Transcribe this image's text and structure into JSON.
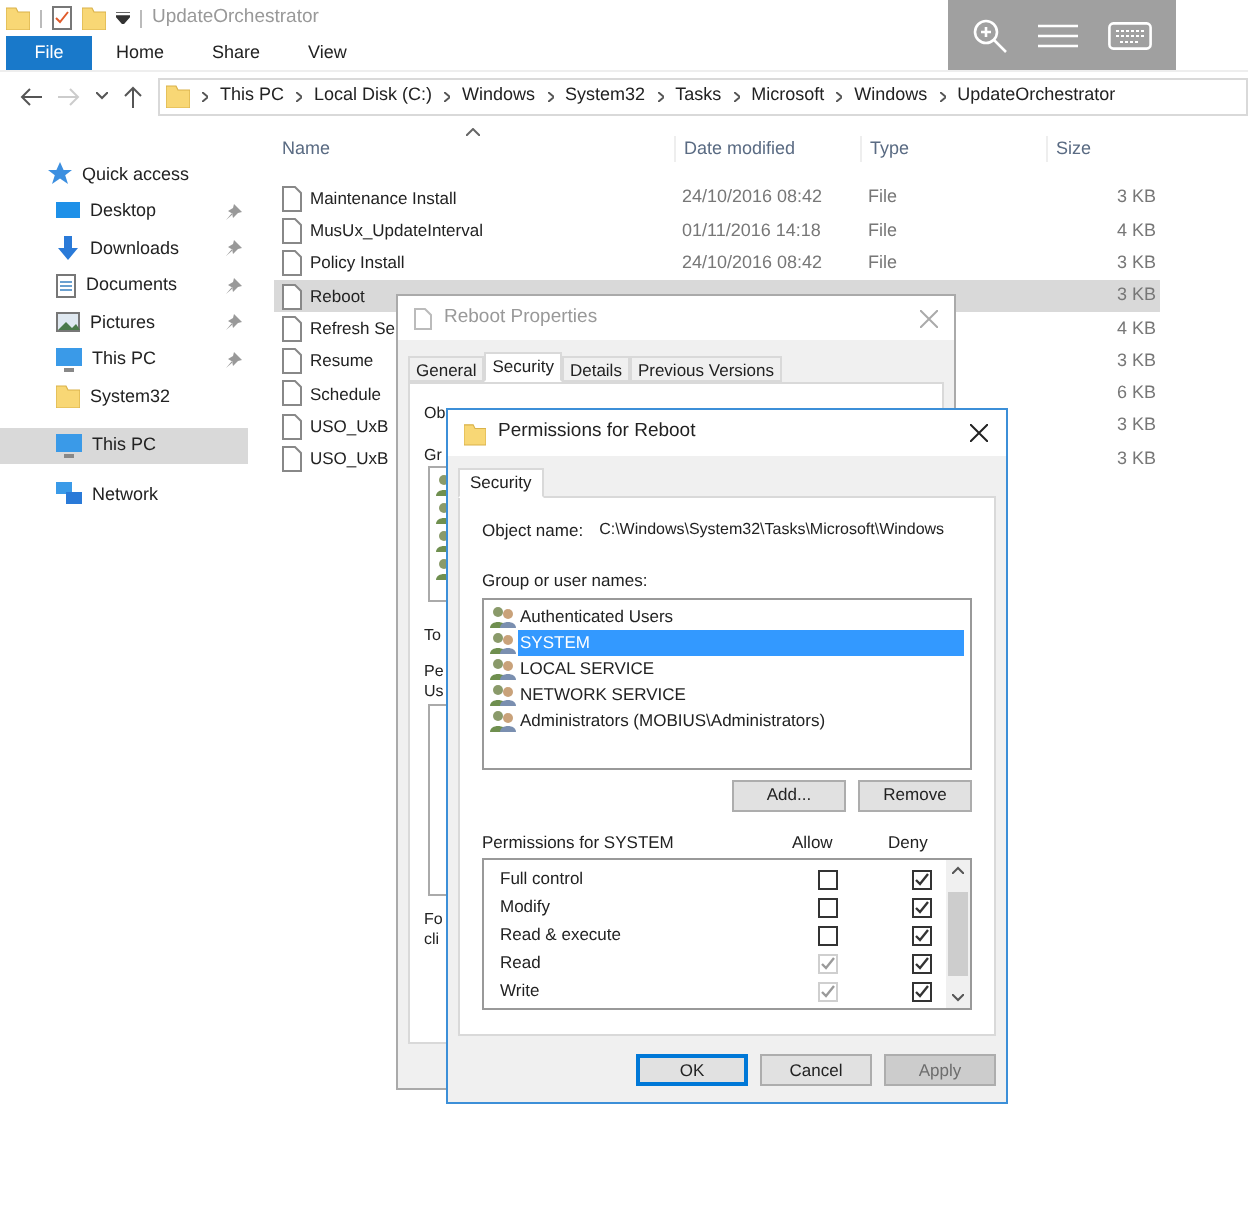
{
  "window": {
    "title": "UpdateOrchestrator"
  },
  "ribbon_tabs": [
    {
      "label": "File",
      "selected": true
    },
    {
      "label": "Home",
      "selected": false
    },
    {
      "label": "Share",
      "selected": false
    },
    {
      "label": "View",
      "selected": false
    }
  ],
  "address": {
    "crumbs": [
      "This PC",
      "Local Disk (C:)",
      "Windows",
      "System32",
      "Tasks",
      "Microsoft",
      "Windows",
      "UpdateOrchestrator"
    ]
  },
  "sidebar": {
    "items": [
      {
        "label": "Quick access",
        "pinned": false,
        "selected": false
      },
      {
        "label": "Desktop",
        "pinned": true,
        "selected": false
      },
      {
        "label": "Downloads",
        "pinned": true,
        "selected": false
      },
      {
        "label": "Documents",
        "pinned": true,
        "selected": false
      },
      {
        "label": "Pictures",
        "pinned": true,
        "selected": false
      },
      {
        "label": "This PC",
        "pinned": true,
        "selected": false
      },
      {
        "label": "System32",
        "pinned": false,
        "selected": false
      },
      {
        "label": "This PC",
        "pinned": false,
        "selected": true
      },
      {
        "label": "Network",
        "pinned": false,
        "selected": false
      }
    ]
  },
  "table": {
    "columns": [
      "Name",
      "Date modified",
      "Type",
      "Size"
    ],
    "rows": [
      {
        "name": "Maintenance Install",
        "date": "24/10/2016 08:42",
        "type": "File",
        "size": "3 KB",
        "selected": false
      },
      {
        "name": "MusUx_UpdateInterval",
        "date": "01/11/2016 14:18",
        "type": "File",
        "size": "4 KB",
        "selected": false
      },
      {
        "name": "Policy Install",
        "date": "24/10/2016 08:42",
        "type": "File",
        "size": "3 KB",
        "selected": false
      },
      {
        "name": "Reboot",
        "size": "3 KB",
        "selected": true
      },
      {
        "name": "Refresh Se",
        "size": "4 KB",
        "selected": false
      },
      {
        "name": "Resume",
        "size": "3 KB",
        "selected": false
      },
      {
        "name": "Schedule",
        "size": "6 KB",
        "selected": false
      },
      {
        "name": "USO_UxB",
        "size": "3 KB",
        "selected": false
      },
      {
        "name": "USO_UxB",
        "size": "3 KB",
        "selected": false
      }
    ]
  },
  "properties_dialog": {
    "title": "Reboot Properties",
    "tabs": [
      {
        "label": "General",
        "selected": false
      },
      {
        "label": "Security",
        "selected": true
      },
      {
        "label": "Details",
        "selected": false
      },
      {
        "label": "Previous Versions",
        "selected": false
      }
    ],
    "fragments": [
      "Ob",
      "Gr",
      "To",
      "Pe",
      "Us",
      "Fo",
      "cli"
    ]
  },
  "permissions_dialog": {
    "title": "Permissions for Reboot",
    "tab": "Security",
    "object_label": "Object name:",
    "object_value": "C:\\Windows\\System32\\Tasks\\Microsoft\\Windows",
    "group_label": "Group or user names:",
    "users": [
      {
        "name": "Authenticated Users",
        "selected": false
      },
      {
        "name": "SYSTEM",
        "selected": true
      },
      {
        "name": "LOCAL SERVICE",
        "selected": false
      },
      {
        "name": "NETWORK SERVICE",
        "selected": false
      },
      {
        "name": "Administrators (MOBIUS\\Administrators)",
        "selected": false
      }
    ],
    "add_button": "Add...",
    "remove_button": "Remove",
    "permissions_label": "Permissions for SYSTEM",
    "allow_label": "Allow",
    "deny_label": "Deny",
    "permissions": [
      {
        "label": "Full control",
        "allow": {
          "checked": false,
          "disabled": false
        },
        "deny": {
          "checked": true,
          "disabled": false
        }
      },
      {
        "label": "Modify",
        "allow": {
          "checked": false,
          "disabled": false
        },
        "deny": {
          "checked": true,
          "disabled": false
        }
      },
      {
        "label": "Read & execute",
        "allow": {
          "checked": false,
          "disabled": false
        },
        "deny": {
          "checked": true,
          "disabled": false
        }
      },
      {
        "label": "Read",
        "allow": {
          "checked": true,
          "disabled": true
        },
        "deny": {
          "checked": true,
          "disabled": false
        }
      },
      {
        "label": "Write",
        "allow": {
          "checked": true,
          "disabled": true
        },
        "deny": {
          "checked": true,
          "disabled": false
        }
      }
    ],
    "buttons": [
      {
        "label": "OK",
        "kind": "default",
        "disabled": false
      },
      {
        "label": "Cancel",
        "kind": "normal",
        "disabled": false
      },
      {
        "label": "Apply",
        "kind": "normal",
        "disabled": true
      }
    ]
  }
}
